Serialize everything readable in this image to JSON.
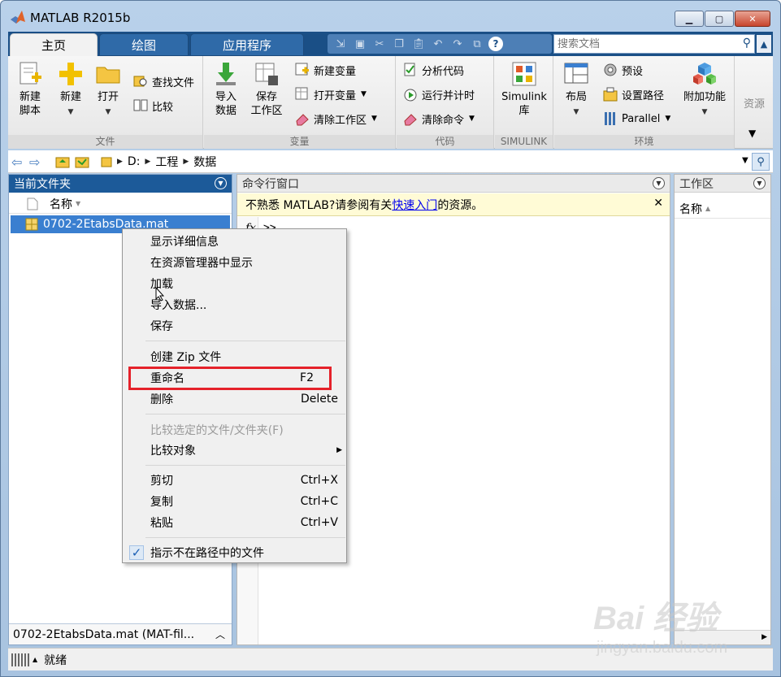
{
  "window": {
    "title": "MATLAB R2015b"
  },
  "tabs": [
    {
      "label": "主页"
    },
    {
      "label": "绘图"
    },
    {
      "label": "应用程序"
    }
  ],
  "search": {
    "placeholder": "搜索文档"
  },
  "ribbon": {
    "file_group": {
      "label": "文件",
      "new_script": "新建\n脚本",
      "new": "新建",
      "open": "打开",
      "find_files": "查找文件",
      "compare": "比较"
    },
    "variable_group": {
      "label": "变量",
      "import_data": "导入\n数据",
      "save_workspace": "保存\n工作区",
      "new_variable": "新建变量",
      "open_variable": "打开变量",
      "clear_workspace": "清除工作区"
    },
    "code_group": {
      "label": "代码",
      "analyze_code": "分析代码",
      "run_and_time": "运行并计时",
      "clear_commands": "清除命令"
    },
    "simulink_group": {
      "label": "SIMULINK",
      "simulink_library": "Simulink\n库"
    },
    "environment_group": {
      "label": "环境",
      "layout": "布局",
      "preferences": "预设",
      "set_path": "设置路径",
      "parallel": "Parallel",
      "add_ons": "附加功能"
    },
    "resources_group": {
      "label": "资源"
    }
  },
  "address": {
    "crumbs": [
      "D:",
      "工程",
      "数据"
    ]
  },
  "files_panel": {
    "title": "当前文件夹",
    "column_name": "名称",
    "selected_file": "0702-2EtabsData.mat",
    "footer": "0702-2EtabsData.mat  (MAT-fil..."
  },
  "command_window": {
    "title": "命令行窗口",
    "notice_prefix": "不熟悉 MATLAB?请参阅有关",
    "notice_link": "快速入门",
    "notice_suffix": "的资源。",
    "fx": "fx",
    "prompt": ">>"
  },
  "workspace": {
    "title": "工作区",
    "column_name": "名称"
  },
  "status": {
    "text": "就绪"
  },
  "context_menu": {
    "items": [
      {
        "label": "显示详细信息",
        "shortcut": ""
      },
      {
        "label": "在资源管理器中显示",
        "shortcut": ""
      },
      {
        "label": "加载",
        "shortcut": ""
      },
      {
        "label": "导入数据...",
        "shortcut": ""
      },
      {
        "label": "保存",
        "shortcut": ""
      },
      {
        "label": "创建 Zip 文件",
        "shortcut": ""
      },
      {
        "label": "重命名",
        "shortcut": "F2"
      },
      {
        "label": "删除",
        "shortcut": "Delete"
      },
      {
        "label": "比较选定的文件/文件夹(F)",
        "shortcut": ""
      },
      {
        "label": "比较对象",
        "shortcut": ""
      },
      {
        "label": "剪切",
        "shortcut": "Ctrl+X"
      },
      {
        "label": "复制",
        "shortcut": "Ctrl+C"
      },
      {
        "label": "粘贴",
        "shortcut": "Ctrl+V"
      },
      {
        "label": "指示不在路径中的文件",
        "shortcut": ""
      }
    ]
  },
  "watermark": {
    "main": "Bai 经验",
    "sub": "jingyan.baidu.com"
  },
  "colors": {
    "ribbon_tab_bg": "#1a4f86",
    "selection": "#3a7fd0",
    "highlight_box": "#e5212a"
  }
}
